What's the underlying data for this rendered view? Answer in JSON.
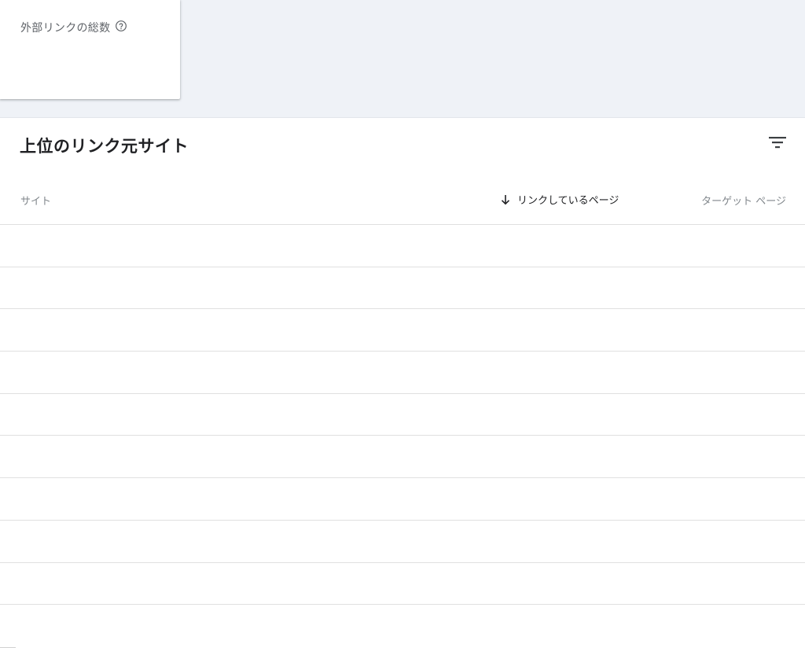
{
  "summary_card": {
    "label": "外部リンクの総数"
  },
  "top_sites_panel": {
    "title": "上位のリンク元サイト",
    "columns": {
      "site": "サイト",
      "linking_pages": "リンクしているページ",
      "target_pages": "ターゲット ページ"
    },
    "sort": {
      "column": "linking_pages",
      "direction": "descending"
    },
    "rows": [
      {
        "site": "",
        "linking_pages": "",
        "target_pages": ""
      },
      {
        "site": "",
        "linking_pages": "",
        "target_pages": ""
      },
      {
        "site": "",
        "linking_pages": "",
        "target_pages": ""
      },
      {
        "site": "",
        "linking_pages": "",
        "target_pages": ""
      },
      {
        "site": "",
        "linking_pages": "",
        "target_pages": ""
      },
      {
        "site": "",
        "linking_pages": "",
        "target_pages": ""
      },
      {
        "site": "",
        "linking_pages": "",
        "target_pages": ""
      },
      {
        "site": "",
        "linking_pages": "",
        "target_pages": ""
      },
      {
        "site": "",
        "linking_pages": "",
        "target_pages": ""
      },
      {
        "site": "",
        "linking_pages": "",
        "target_pages": ""
      }
    ]
  },
  "icons": {
    "help": "help-circle-icon",
    "filter": "filter-list-icon",
    "sort": "arrow-down-icon"
  },
  "colors": {
    "page_background": "#eff2f7",
    "card_background": "#ffffff",
    "primary_text": "#202124",
    "secondary_text": "#80868b",
    "divider": "#e0e0e0"
  }
}
